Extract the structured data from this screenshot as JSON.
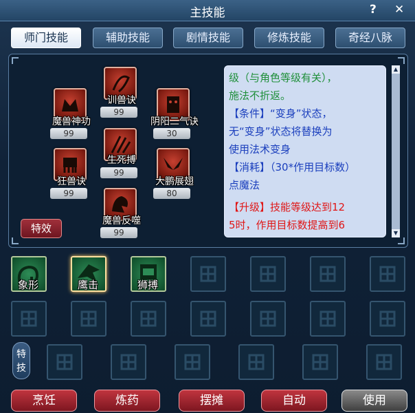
{
  "window": {
    "title": "主技能",
    "help": "?",
    "close": "✕"
  },
  "tabs": [
    {
      "label": "师门技能",
      "active": true
    },
    {
      "label": "辅助技能"
    },
    {
      "label": "剧情技能"
    },
    {
      "label": "修炼技能"
    },
    {
      "label": "奇经八脉"
    }
  ],
  "skills": [
    {
      "name": "训兽诀",
      "level": "99"
    },
    {
      "name": "魔兽神功",
      "level": "99"
    },
    {
      "name": "阴阳二气诀",
      "level": "30"
    },
    {
      "name": "生死搏",
      "level": "99"
    },
    {
      "name": "狂兽诀",
      "level": "99"
    },
    {
      "name": "大鹏展翅",
      "level": "80"
    },
    {
      "name": "魔兽反噬",
      "level": "99"
    }
  ],
  "effect_button": "特效",
  "description": {
    "line1": "级（与角色等级有关），",
    "line2": "施法不折返。",
    "line3": "【条件】“变身”状态，",
    "line4": "无“变身”状态将替换为",
    "line5": "使用法术变身",
    "line6": "【消耗】（30*作用目标数）",
    "line7": "点魔法",
    "line8": "【升级】技能等级达到12",
    "line9": "5时，作用目标数提高到6"
  },
  "grid_skills": [
    {
      "name": "象形"
    },
    {
      "name": "鹰击",
      "selected": true
    },
    {
      "name": "狮搏"
    }
  ],
  "special_label": "特技",
  "buttons": [
    {
      "label": "烹饪"
    },
    {
      "label": "炼药"
    },
    {
      "label": "摆摊"
    },
    {
      "label": "自动"
    },
    {
      "label": "使用"
    }
  ],
  "colors": {
    "accent_red": "#c0353f",
    "desc_green": "#1f8f3a",
    "desc_blue": "#1b3fbd",
    "desc_red": "#e01616"
  }
}
